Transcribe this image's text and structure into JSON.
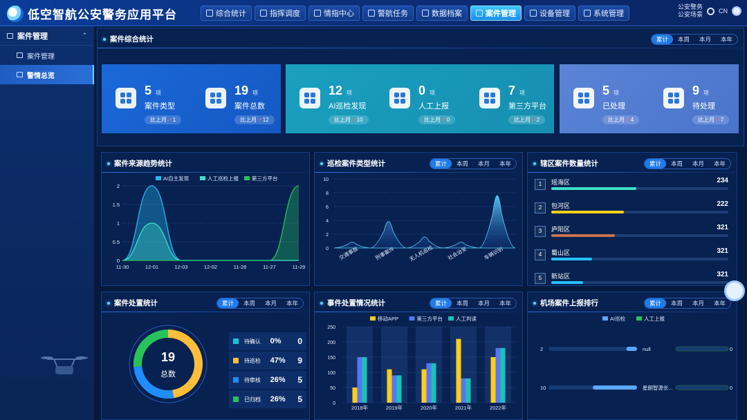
{
  "header": {
    "title": "低空智航公安警务应用平台",
    "nav": [
      "综合统计",
      "指挥调度",
      "情指中心",
      "警航任务",
      "数据档案",
      "案件管理",
      "设备管理",
      "系统管理"
    ],
    "active_nav": "案件管理",
    "right": {
      "line1": "公安警务",
      "line2": "公安场景",
      "lang": "CN"
    }
  },
  "sidebar": {
    "group": "案件管理",
    "items": [
      "案件管理",
      "警情总览"
    ],
    "active": "警情总览"
  },
  "tabs": [
    "累计",
    "本周",
    "本月",
    "本年"
  ],
  "summary": {
    "title": "案件综合统计",
    "stats": [
      {
        "value": "5",
        "unit": "项",
        "label": "案件类型",
        "cmp": "比上月",
        "delta": "1"
      },
      {
        "value": "19",
        "unit": "项",
        "label": "案件总数",
        "cmp": "比上月",
        "delta": "12"
      },
      {
        "value": "12",
        "unit": "项",
        "label": "AI巡检发现",
        "cmp": "比上月",
        "delta": "10"
      },
      {
        "value": "0",
        "unit": "项",
        "label": "人工上报",
        "cmp": "比上月",
        "delta": "0"
      },
      {
        "value": "7",
        "unit": "项",
        "label": "第三方平台",
        "cmp": "比上月",
        "delta": "2"
      },
      {
        "value": "5",
        "unit": "项",
        "label": "已处理",
        "cmp": "比上月",
        "delta": "4"
      },
      {
        "value": "9",
        "unit": "项",
        "label": "待处理",
        "cmp": "比上月",
        "delta": "7"
      }
    ]
  },
  "source_trend": {
    "title": "案件来源趋势统计"
  },
  "patrol_types": {
    "title": "巡检案件类型统计"
  },
  "district": {
    "title": "辖区案件数量统计",
    "rows": [
      {
        "rank": "1",
        "name": "瑶海区",
        "value": "234",
        "color": "#3ee0c8",
        "ratio": 0.48
      },
      {
        "rank": "2",
        "name": "包河区",
        "value": "222",
        "color": "#ffd21a",
        "ratio": 0.41
      },
      {
        "rank": "3",
        "name": "庐阳区",
        "value": "321",
        "color": "#c8744e",
        "ratio": 0.36
      },
      {
        "rank": "4",
        "name": "蜀山区",
        "value": "321",
        "color": "#27c0ff",
        "ratio": 0.23
      },
      {
        "rank": "5",
        "name": "新站区",
        "value": "321",
        "color": "#27c0ff",
        "ratio": 0.18
      }
    ]
  },
  "disposal": {
    "title": "案件处置统计",
    "total": "19",
    "total_label": "总数",
    "rows": [
      {
        "name": "待确认",
        "pct": "0%",
        "count": "0",
        "color": "#18c3d6"
      },
      {
        "name": "待巡检",
        "pct": "47%",
        "count": "9",
        "color": "#ffbe3a"
      },
      {
        "name": "待审核",
        "pct": "26%",
        "count": "5",
        "color": "#1f8cff"
      },
      {
        "name": "已归档",
        "pct": "26%",
        "count": "5",
        "color": "#27c25a"
      }
    ]
  },
  "events": {
    "title": "事件处置情况统计"
  },
  "airport": {
    "title": "机场案件上报排行"
  },
  "chart_data": [
    {
      "type": "area",
      "x": [
        "11-30",
        "12-01",
        "12-03",
        "12-02",
        "11-28",
        "11-27",
        "11-29"
      ],
      "ylim": [
        0,
        2
      ],
      "yticks": [
        "0",
        "0.5",
        "1",
        "1.5",
        "2"
      ],
      "series": [
        {
          "name": "AI自主发现",
          "color": "#27b6f0",
          "values": [
            0,
            2,
            0,
            0,
            0,
            0,
            0
          ]
        },
        {
          "name": "人工巡检上报",
          "color": "#3ee0c8",
          "values": [
            0,
            1,
            0,
            0,
            0,
            0,
            0
          ]
        },
        {
          "name": "第三方平台",
          "color": "#27c25a",
          "values": [
            0,
            0,
            0,
            0,
            0,
            0,
            2
          ]
        }
      ]
    },
    {
      "type": "area",
      "categories": [
        "交通事故",
        "刑事案件",
        "无人机巡检",
        "社会治安",
        "车辆识别"
      ],
      "ylim": [
        0,
        10
      ],
      "yticks": [
        "0",
        "2",
        "4",
        "6",
        "8",
        "10"
      ],
      "values": [
        1,
        5,
        2,
        1,
        10
      ]
    },
    {
      "type": "bar",
      "categories": [
        "2018年",
        "2019年",
        "2020年",
        "2021年",
        "2022年"
      ],
      "ylim": [
        0,
        250
      ],
      "yticks": [
        "0",
        "50",
        "100",
        "150",
        "200",
        "250"
      ],
      "series": [
        {
          "name": "移动APP",
          "color": "#ffcd1a",
          "values": [
            50,
            110,
            110,
            210,
            150
          ]
        },
        {
          "name": "第三方平台",
          "color": "#5677f2",
          "values": [
            150,
            90,
            130,
            80,
            180
          ]
        },
        {
          "name": "人工判读",
          "color": "#18c3b6",
          "values": [
            150,
            90,
            130,
            80,
            180
          ]
        }
      ]
    },
    {
      "type": "bar",
      "orientation": "horizontal",
      "series": [
        {
          "name": "AI巡检",
          "color": "#5aa8ff"
        },
        {
          "name": "人工上报",
          "color": "#27c25a"
        }
      ],
      "rows": [
        {
          "ai_value": "2",
          "ai_ratio": 0.12,
          "label": "null",
          "manual_value": "0",
          "manual_ratio": 0
        },
        {
          "ai_value": "10",
          "ai_ratio": 0.5,
          "label": "星朗智源长...",
          "manual_value": "0",
          "manual_ratio": 0
        }
      ]
    }
  ]
}
